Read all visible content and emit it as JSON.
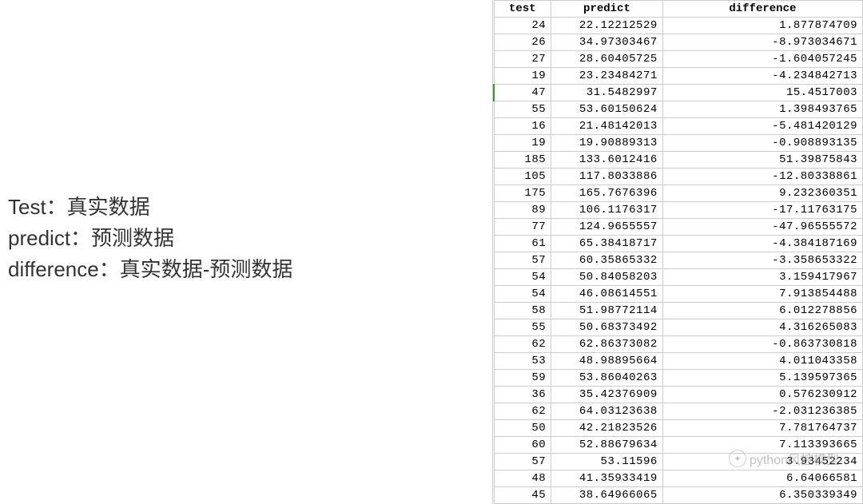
{
  "left_text": {
    "line1": "Test：真实数据",
    "line2": "predict：预测数据",
    "line3": "difference：真实数据-预测数据"
  },
  "table": {
    "headers": {
      "test": "test",
      "predict": "predict",
      "difference": "difference"
    },
    "rows": [
      {
        "test": "24",
        "predict": "22.12212529",
        "difference": "1.877874709"
      },
      {
        "test": "26",
        "predict": "34.97303467",
        "difference": "-8.973034671"
      },
      {
        "test": "27",
        "predict": "28.60405725",
        "difference": "-1.604057245"
      },
      {
        "test": "19",
        "predict": "23.23484271",
        "difference": "-4.234842713"
      },
      {
        "test": "47",
        "predict": "31.5482997",
        "difference": "15.4517003",
        "highlight": true
      },
      {
        "test": "55",
        "predict": "53.60150624",
        "difference": "1.398493765"
      },
      {
        "test": "16",
        "predict": "21.48142013",
        "difference": "-5.481420129"
      },
      {
        "test": "19",
        "predict": "19.90889313",
        "difference": "-0.908893135"
      },
      {
        "test": "185",
        "predict": "133.6012416",
        "difference": "51.39875843"
      },
      {
        "test": "105",
        "predict": "117.8033886",
        "difference": "-12.80338861"
      },
      {
        "test": "175",
        "predict": "165.7676396",
        "difference": "9.232360351"
      },
      {
        "test": "89",
        "predict": "106.1176317",
        "difference": "-17.11763175"
      },
      {
        "test": "77",
        "predict": "124.9655557",
        "difference": "-47.96555572"
      },
      {
        "test": "61",
        "predict": "65.38418717",
        "difference": "-4.384187169"
      },
      {
        "test": "57",
        "predict": "60.35865332",
        "difference": "-3.358653322"
      },
      {
        "test": "54",
        "predict": "50.84058203",
        "difference": "3.159417967"
      },
      {
        "test": "54",
        "predict": "46.08614551",
        "difference": "7.913854488"
      },
      {
        "test": "58",
        "predict": "51.98772114",
        "difference": "6.012278856"
      },
      {
        "test": "55",
        "predict": "50.68373492",
        "difference": "4.316265083"
      },
      {
        "test": "62",
        "predict": "62.86373082",
        "difference": "-0.863730818"
      },
      {
        "test": "53",
        "predict": "48.98895664",
        "difference": "4.011043358"
      },
      {
        "test": "59",
        "predict": "53.86040263",
        "difference": "5.139597365"
      },
      {
        "test": "36",
        "predict": "35.42376909",
        "difference": "0.576230912"
      },
      {
        "test": "62",
        "predict": "64.03123638",
        "difference": "-2.031236385"
      },
      {
        "test": "50",
        "predict": "42.21823526",
        "difference": "7.781764737"
      },
      {
        "test": "60",
        "predict": "52.88679634",
        "difference": "7.113393665"
      },
      {
        "test": "57",
        "predict": "53.11596",
        "difference": "3.93452234"
      },
      {
        "test": "48",
        "predict": "41.35933419",
        "difference": "6.64066581"
      },
      {
        "test": "45",
        "predict": "38.64966065",
        "difference": "6.350339349"
      }
    ]
  },
  "watermark": {
    "text": "python风控模型"
  }
}
